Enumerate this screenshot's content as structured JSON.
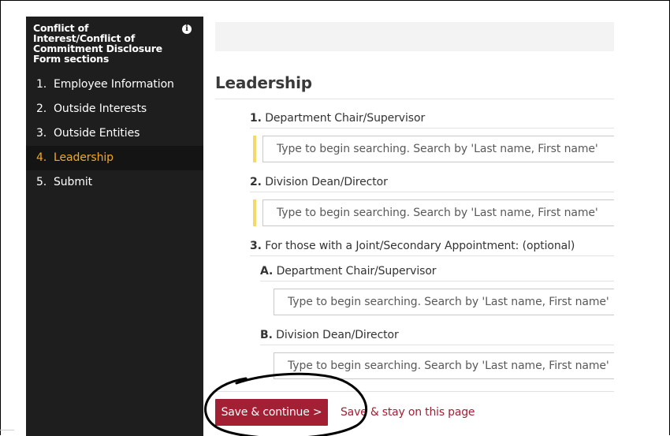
{
  "sidebar": {
    "title": "Conflict of Interest/Conflict of Commitment Disclosure Form sections",
    "info_icon": "info-circle-icon",
    "items": [
      {
        "num": "1.",
        "label": "Employee Information",
        "active": false
      },
      {
        "num": "2.",
        "label": "Outside Interests",
        "active": false
      },
      {
        "num": "3.",
        "label": "Outside Entities",
        "active": false
      },
      {
        "num": "4.",
        "label": "Leadership",
        "active": true
      },
      {
        "num": "5.",
        "label": "Submit",
        "active": false
      }
    ]
  },
  "main": {
    "title": "Leadership",
    "questions": [
      {
        "num": "1.",
        "label": "Department Chair/Supervisor",
        "placeholder": "Type to begin searching. Search by 'Last name, First name'",
        "required": true
      },
      {
        "num": "2.",
        "label": "Division Dean/Director",
        "placeholder": "Type to begin searching. Search by 'Last name, First name'",
        "required": true
      },
      {
        "num": "3.",
        "label": "For those with a Joint/Secondary Appointment: (optional)"
      }
    ],
    "sub_questions": [
      {
        "num": "A.",
        "label": "Department Chair/Supervisor",
        "placeholder": "Type to begin searching. Search by 'Last name, First name'"
      },
      {
        "num": "B.",
        "label": "Division Dean/Director",
        "placeholder": "Type to begin searching. Search by 'Last name, First name'"
      }
    ],
    "save_continue_label": "Save & continue >",
    "save_stay_label": "Save & stay on this page"
  },
  "colors": {
    "sidebar_bg": "#1e1e1e",
    "active_item": "#f2a91e",
    "primary_button": "#a31f34",
    "required_marker": "#f6d76b"
  }
}
